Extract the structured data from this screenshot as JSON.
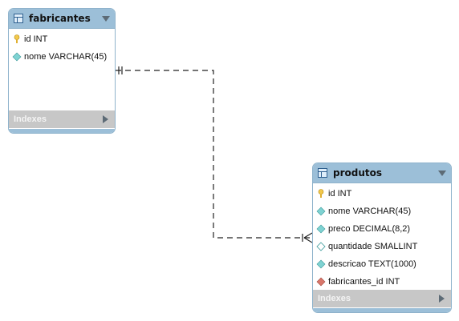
{
  "tables": [
    {
      "name": "fabricantes",
      "columns": [
        {
          "label": "id INT",
          "icon": "key-icon"
        },
        {
          "label": "nome VARCHAR(45)",
          "icon": "column-diamond-icon"
        }
      ],
      "indexes_label": "Indexes"
    },
    {
      "name": "produtos",
      "columns": [
        {
          "label": "id INT",
          "icon": "key-icon"
        },
        {
          "label": "nome VARCHAR(45)",
          "icon": "column-diamond-icon"
        },
        {
          "label": "preco DECIMAL(8,2)",
          "icon": "column-diamond-icon"
        },
        {
          "label": "quantidade SMALLINT",
          "icon": "nullable-column-diamond-icon"
        },
        {
          "label": "descricao TEXT(1000)",
          "icon": "column-diamond-icon"
        },
        {
          "label": "fabricantes_id INT",
          "icon": "foreign-key-diamond-icon"
        }
      ],
      "indexes_label": "Indexes"
    }
  ],
  "relationship": {
    "from": "fabricantes",
    "to": "produtos",
    "cardinality_from": "one-and-only-one",
    "cardinality_to": "one-or-many",
    "line_style": "dashed"
  },
  "colors": {
    "header": "#9cbfd8",
    "border": "#8fb3cc",
    "indexes_bar": "#c7c7c7",
    "key": "#f2c94c",
    "column": "#7fd3d3",
    "foreign_key": "#d9776b"
  }
}
